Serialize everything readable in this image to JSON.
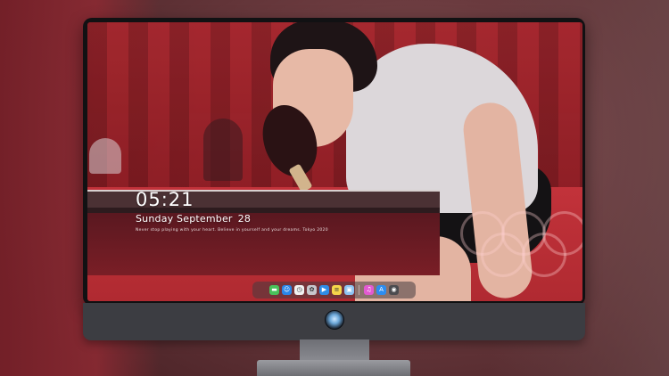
{
  "lockscreen": {
    "time": "05:21",
    "weekday_month": "Sunday September",
    "day": "28",
    "tagline": "Never stop playing with your heart.   Believe in yourself and your dreams.   Tokyo 2020"
  },
  "dock": {
    "apps": [
      {
        "name": "messages",
        "color": "#49c25a",
        "glyph": "▬"
      },
      {
        "name": "finder",
        "color": "#2a86e8",
        "glyph": "☺"
      },
      {
        "name": "clock",
        "color": "#f1f1f1",
        "glyph": "◷"
      },
      {
        "name": "photos",
        "color": "#c7c7cc",
        "glyph": "✿"
      },
      {
        "name": "media",
        "color": "#2f8ce6",
        "glyph": "▶"
      },
      {
        "name": "notes",
        "color": "#f6d64a",
        "glyph": "≡"
      },
      {
        "name": "preview",
        "color": "#8dc3f2",
        "glyph": "▣"
      },
      {
        "name": "itunes",
        "color": "#e35ad0",
        "glyph": "♫"
      },
      {
        "name": "app-store",
        "color": "#2d8df0",
        "glyph": "A"
      },
      {
        "name": "camera",
        "color": "#4b4b4f",
        "glyph": "◉"
      }
    ]
  }
}
